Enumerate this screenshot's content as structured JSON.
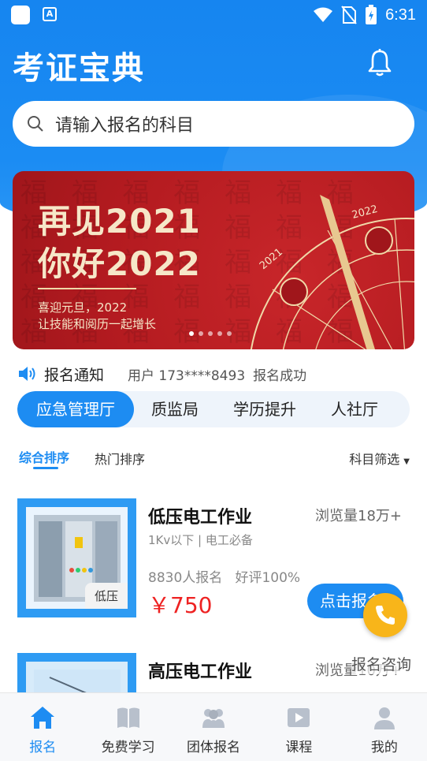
{
  "status_bar": {
    "time": "6:31",
    "a_label": "A"
  },
  "header": {
    "title": "考证宝典"
  },
  "search": {
    "placeholder": "请输入报名的科目"
  },
  "banner": {
    "line1": "再见2021",
    "line2": "你好2022",
    "sub1": "喜迎元旦，2022",
    "sub2": "让技能和阅历一起增长",
    "wheel_year_a": "2021",
    "wheel_year_b": "2022",
    "bg_text": "福 福 福 福 福 福 福 福 福 福 福 福 福 福 福 福 福 福 福 福 福 福 福 福 福 福 福 福 福 福 福 福 福 福 福 福 福 福 福 福",
    "dots": 5,
    "active_dot": 0
  },
  "notice": {
    "label": "报名通知",
    "user": "用户 173****8493",
    "status": "报名成功"
  },
  "category_tabs": [
    {
      "label": "应急管理厅",
      "active": true
    },
    {
      "label": "质监局",
      "active": false
    },
    {
      "label": "学历提升",
      "active": false
    },
    {
      "label": "人社厅",
      "active": false
    }
  ],
  "sort": {
    "comprehensive": "综合排序",
    "popular": "热门排序",
    "filter": "科目筛选"
  },
  "courses": [
    {
      "title": "低压电工作业",
      "views": "浏览量18万+",
      "subtitle": "1Kv以下 | 电工必备",
      "enrolled": "8830人报名",
      "rating": "好评100%",
      "price": "￥750",
      "button": "点击报名",
      "tag": "低压"
    },
    {
      "title": "高压电工作业",
      "views": "浏览量10万+"
    }
  ],
  "consult": {
    "label": "报名咨询"
  },
  "bottom_nav": [
    {
      "label": "报名",
      "icon": "home-icon",
      "active": true
    },
    {
      "label": "免费学习",
      "icon": "book-icon",
      "active": false
    },
    {
      "label": "团体报名",
      "icon": "group-icon",
      "active": false
    },
    {
      "label": "课程",
      "icon": "play-icon",
      "active": false
    },
    {
      "label": "我的",
      "icon": "user-icon",
      "active": false
    }
  ],
  "colors": {
    "primary": "#1d8cf2",
    "price": "#e22222",
    "banner_red": "#b41b20",
    "consult": "#f8b51a"
  }
}
